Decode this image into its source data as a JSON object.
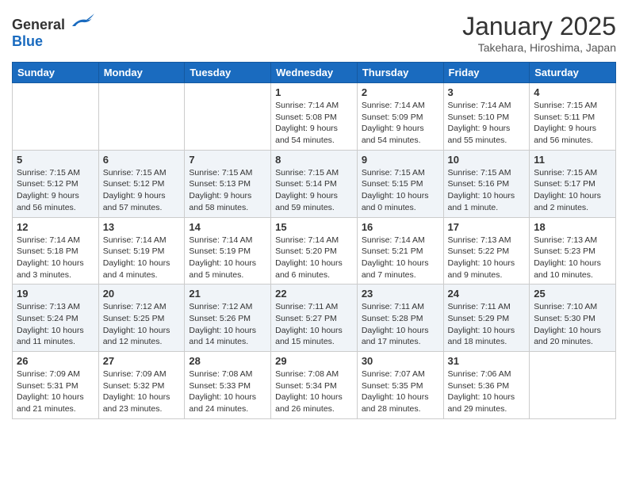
{
  "header": {
    "logo_general": "General",
    "logo_blue": "Blue",
    "month": "January 2025",
    "location": "Takehara, Hiroshima, Japan"
  },
  "days": [
    "Sunday",
    "Monday",
    "Tuesday",
    "Wednesday",
    "Thursday",
    "Friday",
    "Saturday"
  ],
  "weeks": [
    [
      {
        "num": "",
        "info": ""
      },
      {
        "num": "",
        "info": ""
      },
      {
        "num": "",
        "info": ""
      },
      {
        "num": "1",
        "info": "Sunrise: 7:14 AM\nSunset: 5:08 PM\nDaylight: 9 hours\nand 54 minutes."
      },
      {
        "num": "2",
        "info": "Sunrise: 7:14 AM\nSunset: 5:09 PM\nDaylight: 9 hours\nand 54 minutes."
      },
      {
        "num": "3",
        "info": "Sunrise: 7:14 AM\nSunset: 5:10 PM\nDaylight: 9 hours\nand 55 minutes."
      },
      {
        "num": "4",
        "info": "Sunrise: 7:15 AM\nSunset: 5:11 PM\nDaylight: 9 hours\nand 56 minutes."
      }
    ],
    [
      {
        "num": "5",
        "info": "Sunrise: 7:15 AM\nSunset: 5:12 PM\nDaylight: 9 hours\nand 56 minutes."
      },
      {
        "num": "6",
        "info": "Sunrise: 7:15 AM\nSunset: 5:12 PM\nDaylight: 9 hours\nand 57 minutes."
      },
      {
        "num": "7",
        "info": "Sunrise: 7:15 AM\nSunset: 5:13 PM\nDaylight: 9 hours\nand 58 minutes."
      },
      {
        "num": "8",
        "info": "Sunrise: 7:15 AM\nSunset: 5:14 PM\nDaylight: 9 hours\nand 59 minutes."
      },
      {
        "num": "9",
        "info": "Sunrise: 7:15 AM\nSunset: 5:15 PM\nDaylight: 10 hours\nand 0 minutes."
      },
      {
        "num": "10",
        "info": "Sunrise: 7:15 AM\nSunset: 5:16 PM\nDaylight: 10 hours\nand 1 minute."
      },
      {
        "num": "11",
        "info": "Sunrise: 7:15 AM\nSunset: 5:17 PM\nDaylight: 10 hours\nand 2 minutes."
      }
    ],
    [
      {
        "num": "12",
        "info": "Sunrise: 7:14 AM\nSunset: 5:18 PM\nDaylight: 10 hours\nand 3 minutes."
      },
      {
        "num": "13",
        "info": "Sunrise: 7:14 AM\nSunset: 5:19 PM\nDaylight: 10 hours\nand 4 minutes."
      },
      {
        "num": "14",
        "info": "Sunrise: 7:14 AM\nSunset: 5:19 PM\nDaylight: 10 hours\nand 5 minutes."
      },
      {
        "num": "15",
        "info": "Sunrise: 7:14 AM\nSunset: 5:20 PM\nDaylight: 10 hours\nand 6 minutes."
      },
      {
        "num": "16",
        "info": "Sunrise: 7:14 AM\nSunset: 5:21 PM\nDaylight: 10 hours\nand 7 minutes."
      },
      {
        "num": "17",
        "info": "Sunrise: 7:13 AM\nSunset: 5:22 PM\nDaylight: 10 hours\nand 9 minutes."
      },
      {
        "num": "18",
        "info": "Sunrise: 7:13 AM\nSunset: 5:23 PM\nDaylight: 10 hours\nand 10 minutes."
      }
    ],
    [
      {
        "num": "19",
        "info": "Sunrise: 7:13 AM\nSunset: 5:24 PM\nDaylight: 10 hours\nand 11 minutes."
      },
      {
        "num": "20",
        "info": "Sunrise: 7:12 AM\nSunset: 5:25 PM\nDaylight: 10 hours\nand 12 minutes."
      },
      {
        "num": "21",
        "info": "Sunrise: 7:12 AM\nSunset: 5:26 PM\nDaylight: 10 hours\nand 14 minutes."
      },
      {
        "num": "22",
        "info": "Sunrise: 7:11 AM\nSunset: 5:27 PM\nDaylight: 10 hours\nand 15 minutes."
      },
      {
        "num": "23",
        "info": "Sunrise: 7:11 AM\nSunset: 5:28 PM\nDaylight: 10 hours\nand 17 minutes."
      },
      {
        "num": "24",
        "info": "Sunrise: 7:11 AM\nSunset: 5:29 PM\nDaylight: 10 hours\nand 18 minutes."
      },
      {
        "num": "25",
        "info": "Sunrise: 7:10 AM\nSunset: 5:30 PM\nDaylight: 10 hours\nand 20 minutes."
      }
    ],
    [
      {
        "num": "26",
        "info": "Sunrise: 7:09 AM\nSunset: 5:31 PM\nDaylight: 10 hours\nand 21 minutes."
      },
      {
        "num": "27",
        "info": "Sunrise: 7:09 AM\nSunset: 5:32 PM\nDaylight: 10 hours\nand 23 minutes."
      },
      {
        "num": "28",
        "info": "Sunrise: 7:08 AM\nSunset: 5:33 PM\nDaylight: 10 hours\nand 24 minutes."
      },
      {
        "num": "29",
        "info": "Sunrise: 7:08 AM\nSunset: 5:34 PM\nDaylight: 10 hours\nand 26 minutes."
      },
      {
        "num": "30",
        "info": "Sunrise: 7:07 AM\nSunset: 5:35 PM\nDaylight: 10 hours\nand 28 minutes."
      },
      {
        "num": "31",
        "info": "Sunrise: 7:06 AM\nSunset: 5:36 PM\nDaylight: 10 hours\nand 29 minutes."
      },
      {
        "num": "",
        "info": ""
      }
    ]
  ]
}
